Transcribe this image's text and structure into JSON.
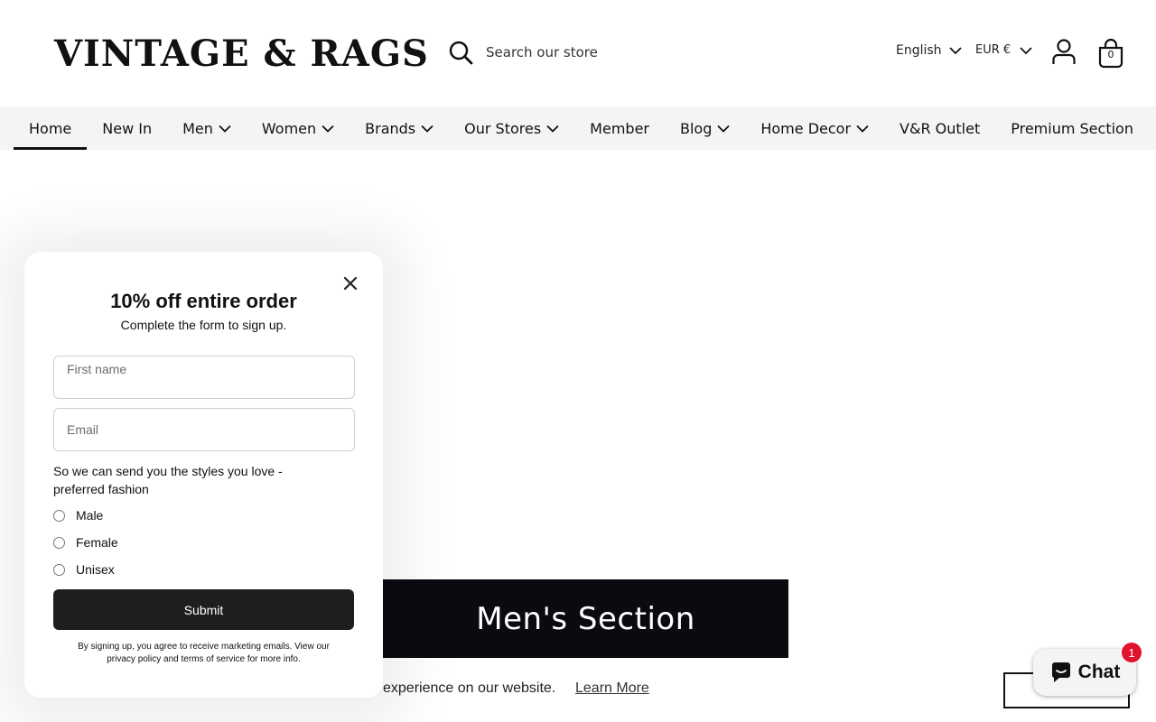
{
  "header": {
    "logo_text": "VINTAGE & RAGS",
    "search_placeholder": "Search our store",
    "language": "English",
    "currency": "EUR €",
    "cart_count": "0",
    "icons": [
      "search-icon",
      "chevron-down-icon",
      "account-icon",
      "shopping-bag-icon"
    ]
  },
  "nav": {
    "items": [
      {
        "label": "Home",
        "active": true,
        "dropdown": false
      },
      {
        "label": "New In",
        "dropdown": false
      },
      {
        "label": "Men",
        "dropdown": true
      },
      {
        "label": "Women",
        "dropdown": true
      },
      {
        "label": "Brands",
        "dropdown": true
      },
      {
        "label": "Our Stores",
        "dropdown": true
      },
      {
        "label": "Member",
        "dropdown": false
      },
      {
        "label": "Blog",
        "dropdown": true
      },
      {
        "label": "Home Decor",
        "dropdown": true
      },
      {
        "label": "V&R Outlet",
        "dropdown": false
      },
      {
        "label": "Premium Section",
        "dropdown": false
      }
    ]
  },
  "hero": {
    "caption": "Men's Section"
  },
  "cookie": {
    "text": "experience on our website.",
    "link": "Learn More"
  },
  "chat": {
    "label": "Chat",
    "badge": "1"
  },
  "popup": {
    "title": "10% off entire order",
    "subtitle": "Complete the form to sign up.",
    "first_name_placeholder": "First name",
    "email_placeholder": "Email",
    "preference_label": "So we can send you the styles you love - preferred fashion",
    "options": [
      "Male",
      "Female",
      "Unisex"
    ],
    "submit_label": "Submit",
    "disclaimer": "By signing up, you agree to receive marketing emails. View our privacy policy and terms of service for more info."
  },
  "colors": {
    "nav_background": "#f4f4f4",
    "hero_caption_background": "#0b0a10",
    "submit_background": "#1e1e1e",
    "chat_badge": "#e0122c"
  }
}
